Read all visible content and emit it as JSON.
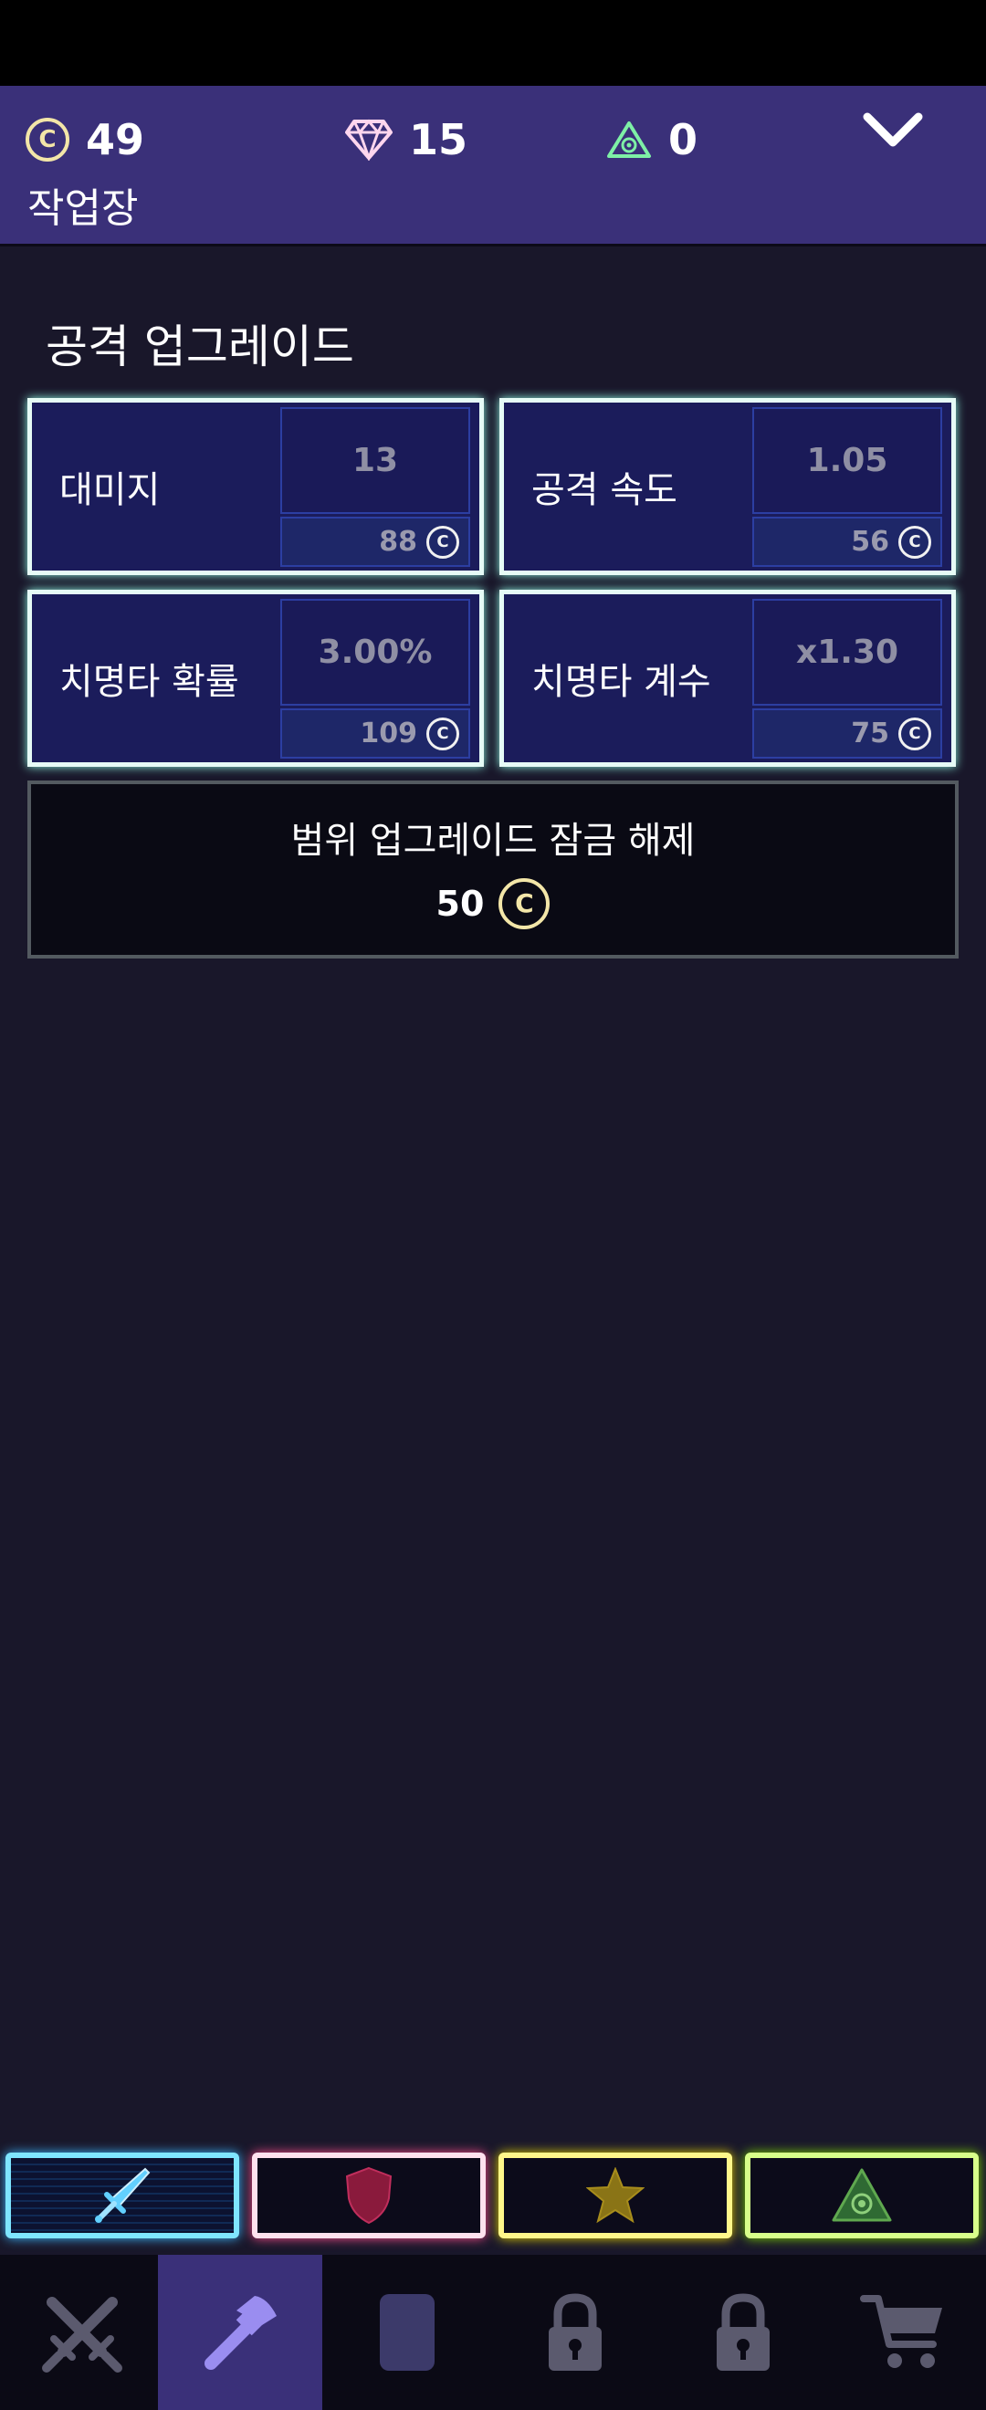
{
  "header": {
    "currencies": {
      "coins": "49",
      "gems": "15",
      "tokens": "0"
    },
    "coin_glyph": "C",
    "title": "작업장"
  },
  "section": {
    "title": "공격 업그레이드"
  },
  "upgrades": [
    {
      "label": "대미지",
      "value": "13",
      "cost": "88"
    },
    {
      "label": "공격 속도",
      "value": "1.05",
      "cost": "56"
    },
    {
      "label": "치명타 확률",
      "value": "3.00%",
      "cost": "109"
    },
    {
      "label": "치명타 계수",
      "value": "x1.30",
      "cost": "75"
    }
  ],
  "unlock": {
    "label": "범위 업그레이드 잠금 해제",
    "cost": "50"
  },
  "category_tabs": [
    {
      "name": "attack",
      "icon": "sword-icon",
      "color": "#7fe6ff"
    },
    {
      "name": "defense",
      "icon": "shield-icon",
      "color": "#ff4f8c"
    },
    {
      "name": "utility",
      "icon": "star-icon",
      "color": "#fff78a"
    },
    {
      "name": "ultimate",
      "icon": "eye-triangle-icon",
      "color": "#d8ff8a"
    }
  ],
  "bottom_nav": [
    {
      "name": "battle",
      "icon": "crossed-swords-icon",
      "active": false
    },
    {
      "name": "workshop",
      "icon": "hammer-icon",
      "active": true
    },
    {
      "name": "cards",
      "icon": "card-icon",
      "active": false
    },
    {
      "name": "locked-1",
      "icon": "lock-icon",
      "active": false
    },
    {
      "name": "locked-2",
      "icon": "lock-icon",
      "active": false
    },
    {
      "name": "shop",
      "icon": "cart-icon",
      "active": false
    }
  ],
  "colors": {
    "header_bg": "#3a3079",
    "page_bg": "#19172a",
    "card_border": "#e6fbf6",
    "card_bg": "#1b1c5b"
  }
}
